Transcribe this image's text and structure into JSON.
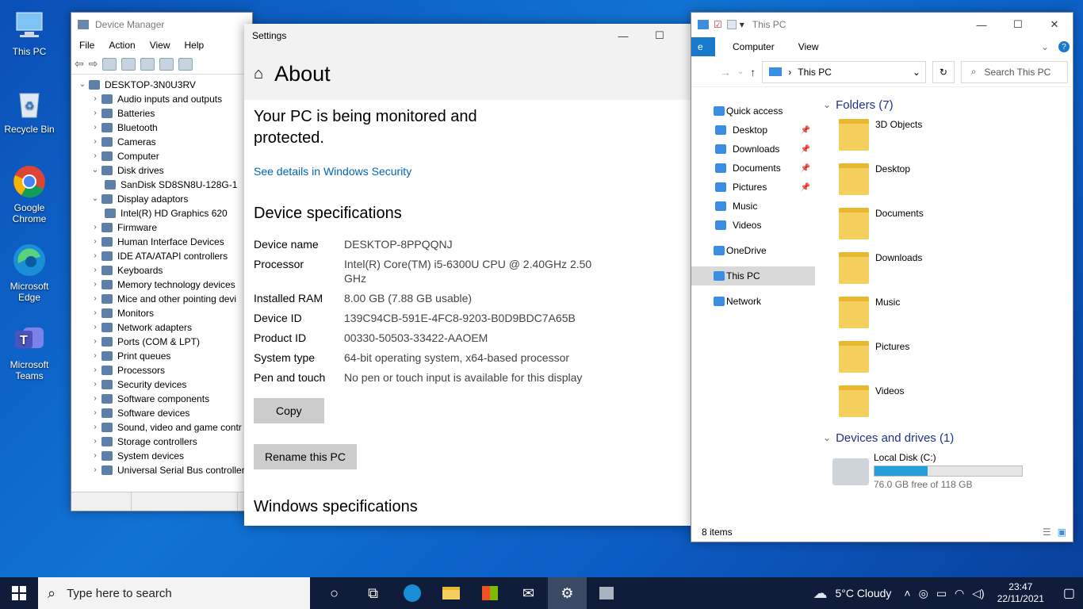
{
  "desktop": {
    "icons": [
      {
        "label": "This PC"
      },
      {
        "label": "Recycle Bin"
      },
      {
        "label": "Google Chrome"
      },
      {
        "label": "Microsoft Edge"
      },
      {
        "label": "Microsoft Teams"
      }
    ]
  },
  "devmgr": {
    "title": "Device Manager",
    "menu": [
      "File",
      "Action",
      "View",
      "Help"
    ],
    "root": "DESKTOP-3N0U3RV",
    "items": [
      {
        "label": "Audio inputs and outputs",
        "chev": "›"
      },
      {
        "label": "Batteries",
        "chev": "›"
      },
      {
        "label": "Bluetooth",
        "chev": "›"
      },
      {
        "label": "Cameras",
        "chev": "›"
      },
      {
        "label": "Computer",
        "chev": "›"
      },
      {
        "label": "Disk drives",
        "chev": "⌄"
      },
      {
        "label": "SanDisk SD8SN8U-128G-1",
        "chev": "",
        "child": true
      },
      {
        "label": "Display adaptors",
        "chev": "⌄"
      },
      {
        "label": "Intel(R) HD Graphics 620",
        "chev": "",
        "child": true
      },
      {
        "label": "Firmware",
        "chev": "›"
      },
      {
        "label": "Human Interface Devices",
        "chev": "›"
      },
      {
        "label": "IDE ATA/ATAPI controllers",
        "chev": "›"
      },
      {
        "label": "Keyboards",
        "chev": "›"
      },
      {
        "label": "Memory technology devices",
        "chev": "›"
      },
      {
        "label": "Mice and other pointing devi",
        "chev": "›"
      },
      {
        "label": "Monitors",
        "chev": "›"
      },
      {
        "label": "Network adapters",
        "chev": "›"
      },
      {
        "label": "Ports (COM & LPT)",
        "chev": "›"
      },
      {
        "label": "Print queues",
        "chev": "›"
      },
      {
        "label": "Processors",
        "chev": "›"
      },
      {
        "label": "Security devices",
        "chev": "›"
      },
      {
        "label": "Software components",
        "chev": "›"
      },
      {
        "label": "Software devices",
        "chev": "›"
      },
      {
        "label": "Sound, video and game contr",
        "chev": "›"
      },
      {
        "label": "Storage controllers",
        "chev": "›"
      },
      {
        "label": "System devices",
        "chev": "›"
      },
      {
        "label": "Universal Serial Bus controller",
        "chev": "›"
      }
    ]
  },
  "settings": {
    "title": "Settings",
    "page_title": "About",
    "protect_text": "Your PC is being monitored and protected.",
    "security_link": "See details in Windows Security",
    "device_spec_heading": "Device specifications",
    "specs": [
      {
        "key": "Device name",
        "value": "DESKTOP-8PPQQNJ"
      },
      {
        "key": "Processor",
        "value": "Intel(R) Core(TM) i5-6300U CPU @ 2.40GHz   2.50 GHz"
      },
      {
        "key": "Installed RAM",
        "value": "8.00 GB (7.88 GB usable)"
      },
      {
        "key": "Device ID",
        "value": "139C94CB-591E-4FC8-9203-B0D9BDC7A65B"
      },
      {
        "key": "Product ID",
        "value": "00330-50503-33422-AAOEM"
      },
      {
        "key": "System type",
        "value": "64-bit operating system, x64-based processor"
      },
      {
        "key": "Pen and touch",
        "value": "No pen or touch input is available for this display"
      }
    ],
    "copy_label": "Copy",
    "rename_label": "Rename this PC",
    "windows_spec_heading": "Windows specifications"
  },
  "explorer": {
    "title": "This PC",
    "ribbon": {
      "file": "e",
      "tabs": [
        "Computer",
        "View"
      ]
    },
    "address": "This PC",
    "search_placeholder": "Search This PC",
    "nav": [
      {
        "label": "Quick access",
        "kind": "top"
      },
      {
        "label": "Desktop",
        "kind": "sub",
        "pin": true
      },
      {
        "label": "Downloads",
        "kind": "sub",
        "pin": true
      },
      {
        "label": "Documents",
        "kind": "sub",
        "pin": true
      },
      {
        "label": "Pictures",
        "kind": "sub",
        "pin": true
      },
      {
        "label": "Music",
        "kind": "sub"
      },
      {
        "label": "Videos",
        "kind": "sub"
      },
      {
        "label": "OneDrive",
        "kind": "top"
      },
      {
        "label": "This PC",
        "kind": "top",
        "selected": true
      },
      {
        "label": "Network",
        "kind": "top"
      }
    ],
    "folders_heading": "Folders (7)",
    "folders": [
      "3D Objects",
      "Desktop",
      "Documents",
      "Downloads",
      "Music",
      "Pictures",
      "Videos"
    ],
    "devices_heading": "Devices and drives (1)",
    "drive": {
      "name": "Local Disk (C:)",
      "free_text": "76.0 GB free of 118 GB",
      "used_fraction": 0.36
    },
    "status": "8 items"
  },
  "taskbar": {
    "search_placeholder": "Type here to search",
    "weather": "5°C  Cloudy",
    "time": "23:47",
    "date": "22/11/2021"
  },
  "colors": {
    "accent": "#0067b8",
    "taskbar": "#0f1d3a",
    "drive_fill": "#26a0da"
  }
}
